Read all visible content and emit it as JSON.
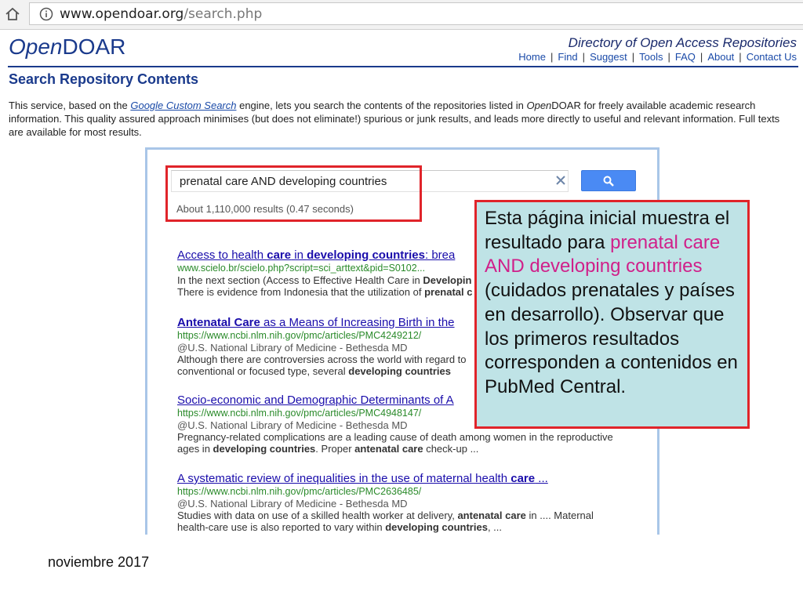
{
  "browser": {
    "url_domain": "www.opendoar.org",
    "url_path": "/search.php"
  },
  "site": {
    "logo_part1": "Open",
    "logo_part2": "DOAR",
    "directory_title": "Directory of Open Access Repositories",
    "nav": [
      "Home",
      "Find",
      "Suggest",
      "Tools",
      "FAQ",
      "About",
      "Contact Us"
    ]
  },
  "page": {
    "title": "Search Repository Contents",
    "intro_1": "This service, based on the ",
    "intro_link": "Google Custom Search",
    "intro_2": " engine, lets you search the contents of the repositories listed in ",
    "intro_open": "Open",
    "intro_3": "DOAR for freely available academic research information. This quality assured approach minimises (but does not eliminate!) spurious or junk results, and leads more directly to useful and relevant information. Full texts are available for most results."
  },
  "search": {
    "query": "prenatal care AND developing countries",
    "stats": "About 1,110,000 results (0.47 seconds)"
  },
  "results": [
    {
      "title_html": "Access to health <b>care</b> in <b>developing countries</b>: brea",
      "url": "www.scielo.br/scielo.php?script=sci_arttext&pid=S0102...",
      "meta": "",
      "snippet1": "In the next section (Access to Effective Health Care in <b>Developin</b>",
      "snippet2": "There is evidence from Indonesia that the utilization of <b>prenatal c</b>"
    },
    {
      "title_html": "<b>Antenatal Care</b> as a Means of Increasing Birth in the",
      "url": "https://www.ncbi.nlm.nih.gov/pmc/articles/PMC4249212/",
      "meta": "@U.S. National Library of Medicine - Bethesda MD",
      "snippet1": "Although there are controversies across the world with regard to",
      "snippet2": "conventional or focused type, several <b>developing countries</b>"
    },
    {
      "title_html": "Socio-economic and Demographic Determinants of A",
      "url": "https://www.ncbi.nlm.nih.gov/pmc/articles/PMC4948147/",
      "meta": "@U.S. National Library of Medicine - Bethesda MD",
      "snippet1": "Pregnancy-related complications are a leading cause of death among women in the reproductive",
      "snippet2": "ages in <b>developing countries</b>. Proper <b>antenatal care</b> check-up ..."
    },
    {
      "title_html": "A systematic review of inequalities in the use of maternal health <b>care</b> ...",
      "url": "https://www.ncbi.nlm.nih.gov/pmc/articles/PMC2636485/",
      "meta": "@U.S. National Library of Medicine - Bethesda MD",
      "snippet1": "Studies with data on use of a skilled health worker at delivery, <b>antenatal care</b> in .... Maternal",
      "snippet2": "health-care use is also reported to vary within <b>developing countries</b>, ..."
    }
  ],
  "callout": {
    "text_1": "Esta página inicial muestra el resultado para ",
    "text_pink": "prenatal care AND developing countries",
    "text_2": " (cuidados prenatales y países en desarrollo). Observar que los primeros resultados corresponden a contenidos en PubMed Central."
  },
  "footer": {
    "date": "noviembre 2017"
  },
  "colors": {
    "link": "#1a0dab",
    "url_green": "#2a8a2a",
    "callout_bg": "#bfe3e6",
    "highlight_red": "#e0242a",
    "callout_pink": "#d0208a",
    "brand_blue": "#1a3a8c"
  }
}
